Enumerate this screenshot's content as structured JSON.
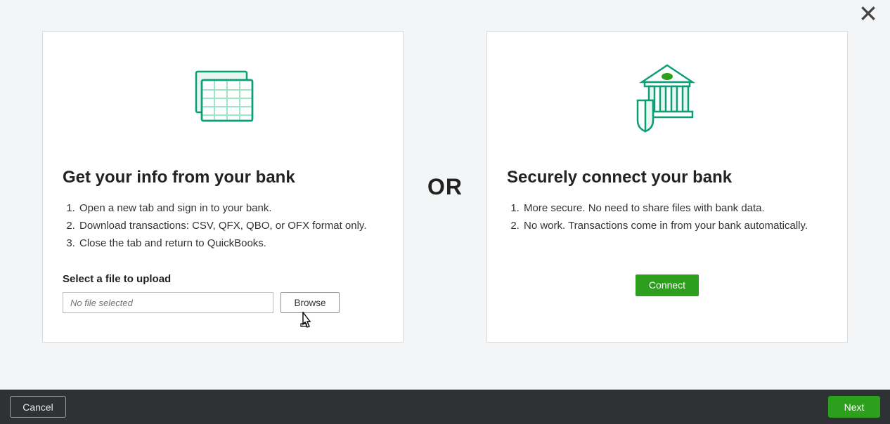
{
  "left_card": {
    "heading": "Get your info from your bank",
    "steps": [
      "Open a new tab and sign in to your bank.",
      "Download transactions: CSV, QFX, QBO, or OFX format only.",
      "Close the tab and return to QuickBooks."
    ],
    "upload_label": "Select a file to upload",
    "file_placeholder": "No file selected",
    "browse_label": "Browse"
  },
  "separator": "OR",
  "right_card": {
    "heading": "Securely connect your bank",
    "steps": [
      "More secure. No need to share files with bank data.",
      "No work. Transactions come in from your bank automatically."
    ],
    "connect_label": "Connect"
  },
  "footer": {
    "cancel_label": "Cancel",
    "next_label": "Next"
  }
}
